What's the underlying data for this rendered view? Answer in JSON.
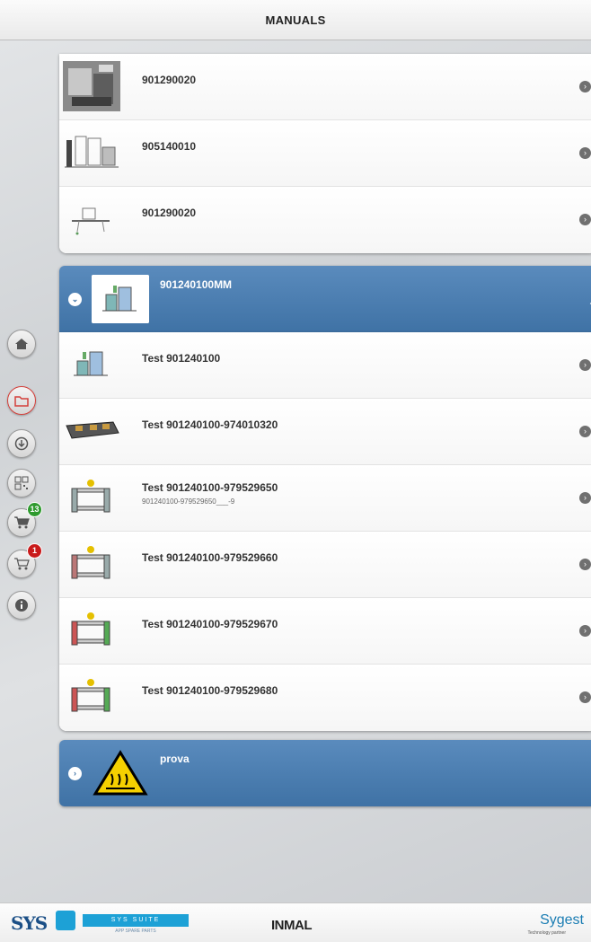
{
  "header": {
    "title": "MANUALS"
  },
  "group1": {
    "items": [
      {
        "label": "901290020",
        "thumb": "machine-photo"
      },
      {
        "label": "905140010",
        "thumb": "machine-drawing"
      },
      {
        "label": "901290020",
        "thumb": "machine-drawing"
      }
    ]
  },
  "group2": {
    "label": "901240100MM",
    "expanded": true,
    "items": [
      {
        "label": "Test 901240100"
      },
      {
        "label": "Test 901240100-974010320"
      },
      {
        "label": "Test 901240100-979529650",
        "sublabel": "901240100-979529650___-9"
      },
      {
        "label": "Test 901240100-979529660"
      },
      {
        "label": "Test 901240100-979529670"
      },
      {
        "label": "Test 901240100-979529680"
      }
    ]
  },
  "group3": {
    "label": "prova",
    "expanded": false,
    "thumb": "hot-surface-warning-icon"
  },
  "sidebar": {
    "buttons": [
      {
        "name": "home-icon"
      },
      {
        "name": "folder-icon",
        "active": true
      },
      {
        "name": "download-icon"
      },
      {
        "name": "qr-code-icon"
      },
      {
        "name": "cart-icon",
        "badge": "13",
        "badge_color": "#2e9a2e"
      },
      {
        "name": "cart-outline-icon",
        "badge": "1",
        "badge_color": "#c91a1a"
      },
      {
        "name": "info-icon"
      }
    ]
  },
  "footer": {
    "sys_logo": "SYS",
    "suite_text": "SYS SUITE",
    "suite_sub": "APP SPARE PARTS",
    "inmal_logo": "INMAL",
    "sygest_logo": "Sygest",
    "sygest_sub": "Technology partner"
  },
  "colors": {
    "header_blue": "#3f72a5",
    "badge_green": "#2e9a2e",
    "badge_red": "#c91a1a"
  }
}
